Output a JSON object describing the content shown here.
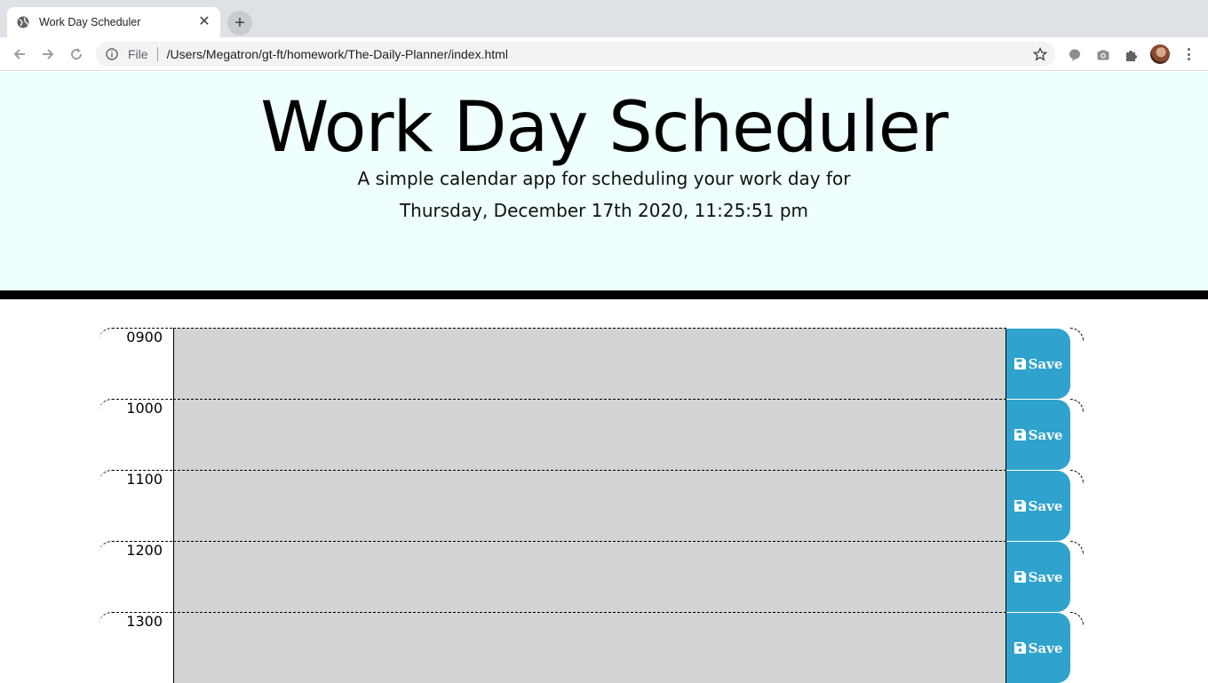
{
  "browser": {
    "tab_title": "Work Day Scheduler",
    "close_glyph": "✕",
    "new_tab_glyph": "+",
    "scheme_label": "File",
    "url": "/Users/Megatron/gt-ft/homework/The-Daily-Planner/index.html"
  },
  "header": {
    "title": "Work Day Scheduler",
    "lead": "A simple calendar app for scheduling your work day for",
    "current_day": "Thursday, December 17th 2020, 11:25:51 pm"
  },
  "schedule": {
    "rows": [
      {
        "hour": "0900",
        "text": "",
        "save_label": "Save"
      },
      {
        "hour": "1000",
        "text": "",
        "save_label": "Save"
      },
      {
        "hour": "1100",
        "text": "",
        "save_label": "Save"
      },
      {
        "hour": "1200",
        "text": "",
        "save_label": "Save"
      },
      {
        "hour": "1300",
        "text": "",
        "save_label": "Save"
      }
    ]
  },
  "colors": {
    "jumbotron_bg": "#eefffe",
    "past_block": "#d3d3d3",
    "save_button": "#2fa3cd"
  }
}
